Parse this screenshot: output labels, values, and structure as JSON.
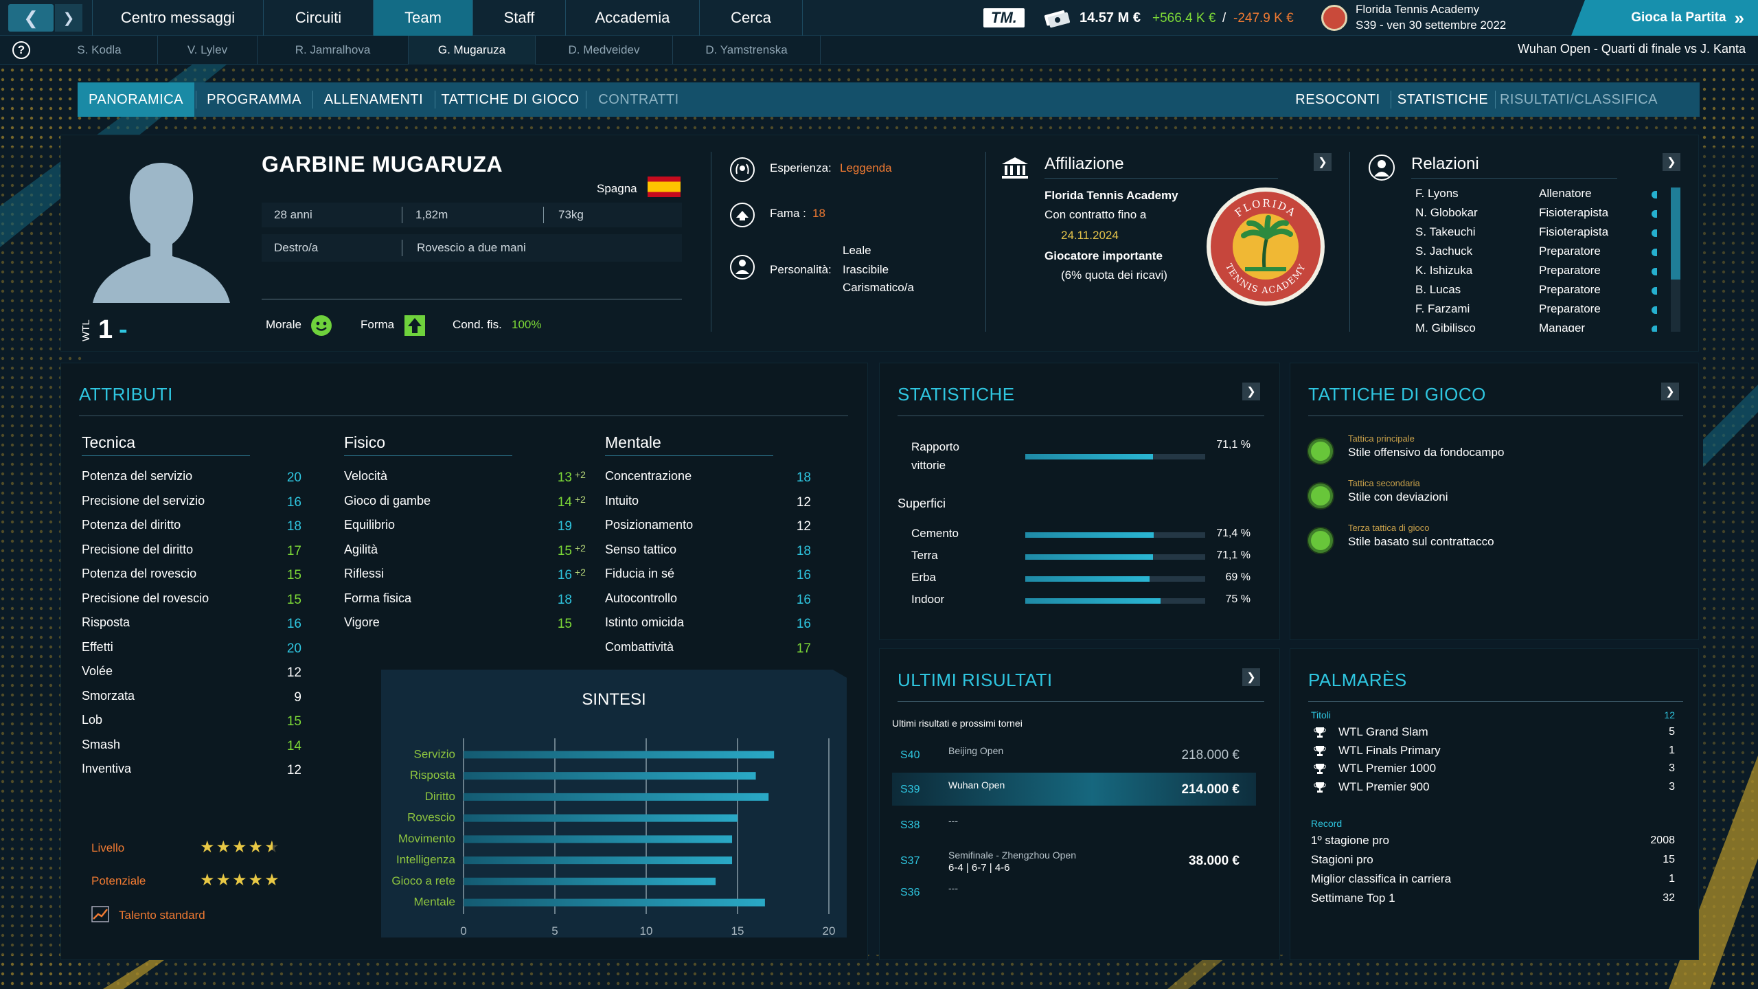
{
  "topbar": {
    "nav": [
      "Centro messaggi",
      "Circuiti",
      "Team",
      "Staff",
      "Accademia",
      "Cerca"
    ],
    "active_nav": "Team",
    "brand": "TM.",
    "money": "14.57 M €",
    "income": "+566.4 K €",
    "separator": "/",
    "expense": "-247.9 K €",
    "club_name": "Florida Tennis Academy",
    "date": "S39 - ven 30 settembre 2022",
    "play_button": "Gioca la Partita"
  },
  "players_bar": {
    "players": [
      "S. Kodla",
      "V. Lylev",
      "R. Jamralhova",
      "G. Mugaruza",
      "D. Medveidev",
      "D. Yamstrenska"
    ],
    "active_player": "G. Mugaruza",
    "match_info": "Wuhan Open - Quarti di finale vs J. Kanta"
  },
  "tabs": {
    "left": [
      "PANORAMICA",
      "PROGRAMMA",
      "ALLENAMENTI",
      "TATTICHE DI GIOCO",
      "CONTRATTI"
    ],
    "right": [
      "RESOCONTI",
      "STATISTICHE",
      "RISULTATI/CLASSIFICA"
    ]
  },
  "profile": {
    "name": "GARBINE MUGARUZA",
    "country": "Spagna",
    "age": "28 anni",
    "height": "1,82m",
    "weight": "73kg",
    "hand": "Destro/a",
    "backhand": "Rovescio a due mani",
    "ranking_label": "WTL",
    "ranking": "1",
    "ranking_trend": "-",
    "morale_label": "Morale",
    "form_label": "Forma",
    "fitness_label": "Cond. fis.",
    "fitness_value": "100%"
  },
  "traits": {
    "experience_label": "Esperienza:",
    "experience_value": "Leggenda",
    "fame_label": "Fama :",
    "fame_value": "18",
    "personality_label": "Personalità:",
    "personality": [
      "Leale",
      "Irascibile",
      "Carismatico/a"
    ]
  },
  "affiliation": {
    "title": "Affiliazione",
    "academy": "Florida Tennis Academy",
    "contract_label": "Con contratto fino a",
    "contract_date": "24.11.2024",
    "role": "Giocatore importante",
    "share": "(6% quota dei ricavi)",
    "logo_top": "FLORIDA",
    "logo_bottom": "TENNIS ACADEMY"
  },
  "relations": {
    "title": "Relazioni",
    "people": [
      {
        "name": "F. Lyons",
        "role": "Allenatore",
        "level": 3
      },
      {
        "name": "N. Globokar",
        "role": "Fisioterapista",
        "level": 3
      },
      {
        "name": "S. Takeuchi",
        "role": "Fisioterapista",
        "level": 3
      },
      {
        "name": "S. Jachuck",
        "role": "Preparatore",
        "level": 4
      },
      {
        "name": "K. Ishizuka",
        "role": "Preparatore",
        "level": 2.5
      },
      {
        "name": "B. Lucas",
        "role": "Preparatore",
        "level": 3.5
      },
      {
        "name": "F. Farzami",
        "role": "Preparatore",
        "level": 2.5
      },
      {
        "name": "M. Gibilisco",
        "role": "Manager",
        "level": 5
      }
    ]
  },
  "attributes": {
    "title": "ATTRIBUTI",
    "tecnica": {
      "title": "Tecnica",
      "items": [
        {
          "name": "Potenza del servizio",
          "value": "20",
          "color": "cyan"
        },
        {
          "name": "Precisione del servizio",
          "value": "16",
          "color": "cyan"
        },
        {
          "name": "Potenza del diritto",
          "value": "18",
          "color": "cyan"
        },
        {
          "name": "Precisione del diritto",
          "value": "17",
          "color": "green"
        },
        {
          "name": "Potenza del rovescio",
          "value": "15",
          "color": "green"
        },
        {
          "name": "Precisione del rovescio",
          "value": "15",
          "color": "green"
        },
        {
          "name": "Risposta",
          "value": "16",
          "color": "cyan"
        },
        {
          "name": "Effetti",
          "value": "20",
          "color": "cyan"
        },
        {
          "name": "Volée",
          "value": "12",
          "color": "white"
        },
        {
          "name": "Smorzata",
          "value": "9",
          "color": "white"
        },
        {
          "name": "Lob",
          "value": "15",
          "color": "green"
        },
        {
          "name": "Smash",
          "value": "14",
          "color": "green"
        },
        {
          "name": "Inventiva",
          "value": "12",
          "color": "white"
        }
      ]
    },
    "fisico": {
      "title": "Fisico",
      "items": [
        {
          "name": "Velocità",
          "value": "13",
          "bonus": "+2",
          "color": "green"
        },
        {
          "name": "Gioco di gambe",
          "value": "14",
          "bonus": "+2",
          "color": "green"
        },
        {
          "name": "Equilibrio",
          "value": "19",
          "bonus": "",
          "color": "cyan"
        },
        {
          "name": "Agilità",
          "value": "15",
          "bonus": "+2",
          "color": "green"
        },
        {
          "name": "Riflessi",
          "value": "16",
          "bonus": "+2",
          "color": "cyan"
        },
        {
          "name": "Forma fisica",
          "value": "18",
          "bonus": "",
          "color": "cyan"
        },
        {
          "name": "Vigore",
          "value": "15",
          "bonus": "",
          "color": "green"
        }
      ]
    },
    "mentale": {
      "title": "Mentale",
      "items": [
        {
          "name": "Concentrazione",
          "value": "18",
          "color": "cyan"
        },
        {
          "name": "Intuito",
          "value": "12",
          "color": "white"
        },
        {
          "name": "Posizionamento",
          "value": "12",
          "color": "white"
        },
        {
          "name": "Senso tattico",
          "value": "18",
          "color": "cyan"
        },
        {
          "name": "Fiducia in sé",
          "value": "16",
          "color": "cyan"
        },
        {
          "name": "Autocontrollo",
          "value": "16",
          "color": "cyan"
        },
        {
          "name": "Istinto omicida",
          "value": "16",
          "color": "cyan"
        },
        {
          "name": "Combattività",
          "value": "17",
          "color": "green"
        }
      ]
    },
    "level_label": "Livello",
    "level_stars": 4.5,
    "potential_label": "Potenziale",
    "potential_stars": 5,
    "talent": "Talento standard"
  },
  "chart_data": {
    "type": "bar",
    "title": "SINTESI",
    "categories": [
      "Servizio",
      "Risposta",
      "Diritto",
      "Rovescio",
      "Movimento",
      "Intelligenza",
      "Gioco a rete",
      "Mentale"
    ],
    "values": [
      17,
      16,
      16.7,
      15,
      14.7,
      14.7,
      13.8,
      16.5
    ],
    "xlim": [
      0,
      20
    ],
    "xticks": [
      "0",
      "5",
      "10",
      "15",
      "20"
    ],
    "grid": true
  },
  "statistics": {
    "title": "STATISTICHE",
    "win_label": "Rapporto vittorie",
    "win_value": "71,1 %",
    "win_fraction": 0.711,
    "surfaces_title": "Superfici",
    "surfaces": [
      {
        "name": "Cemento",
        "value": "71,4 %",
        "fraction": 0.714
      },
      {
        "name": "Terra",
        "value": "71,1 %",
        "fraction": 0.711
      },
      {
        "name": "Erba",
        "value": "69 %",
        "fraction": 0.69
      },
      {
        "name": "Indoor",
        "value": "75 %",
        "fraction": 0.75
      }
    ]
  },
  "tactics": {
    "title": "TATTICHE DI GIOCO",
    "items": [
      {
        "kind": "Tattica principale",
        "name": "Stile offensivo da fondocampo"
      },
      {
        "kind": "Tattica secondaria",
        "name": "Stile con deviazioni"
      },
      {
        "kind": "Terza tattica di gioco",
        "name": "Stile basato sul contrattacco"
      }
    ]
  },
  "results": {
    "title": "ULTIMI RISULTATI",
    "subtitle": "Ultimi risultati e prossimi tornei",
    "rows": [
      {
        "week": "S40",
        "event": "Beijing Open",
        "score": "",
        "prize": "218.000 €"
      },
      {
        "week": "S39",
        "event": "Wuhan Open",
        "score": "",
        "prize": "214.000 €"
      },
      {
        "week": "S38",
        "event": "---",
        "score": "",
        "prize": ""
      },
      {
        "week": "S37",
        "event": "Semifinale - Zhengzhou Open",
        "score": "6-4 | 6-7 | 4-6",
        "prize": "38.000 €"
      },
      {
        "week": "S36",
        "event": "---",
        "score": "",
        "prize": ""
      }
    ]
  },
  "palmares": {
    "title": "PALMARÈS",
    "titles_label": "Titoli",
    "titles_total": "12",
    "titles": [
      {
        "name": "WTL Grand Slam",
        "count": "5"
      },
      {
        "name": "WTL Finals Primary",
        "count": "1"
      },
      {
        "name": "WTL Premier 1000",
        "count": "3"
      },
      {
        "name": "WTL Premier 900",
        "count": "3"
      }
    ],
    "record_label": "Record",
    "records": [
      {
        "name": "1º stagione pro",
        "value": "2008"
      },
      {
        "name": "Stagioni pro",
        "value": "15"
      },
      {
        "name": "Miglior classifica in carriera",
        "value": "1"
      },
      {
        "name": "Settimane Top 1",
        "value": "32"
      }
    ]
  },
  "colors": {
    "accent": "#2fc6e0",
    "bonus": "#7edb37",
    "warning": "#f07a32",
    "tab_active": "#1a8aa5"
  }
}
